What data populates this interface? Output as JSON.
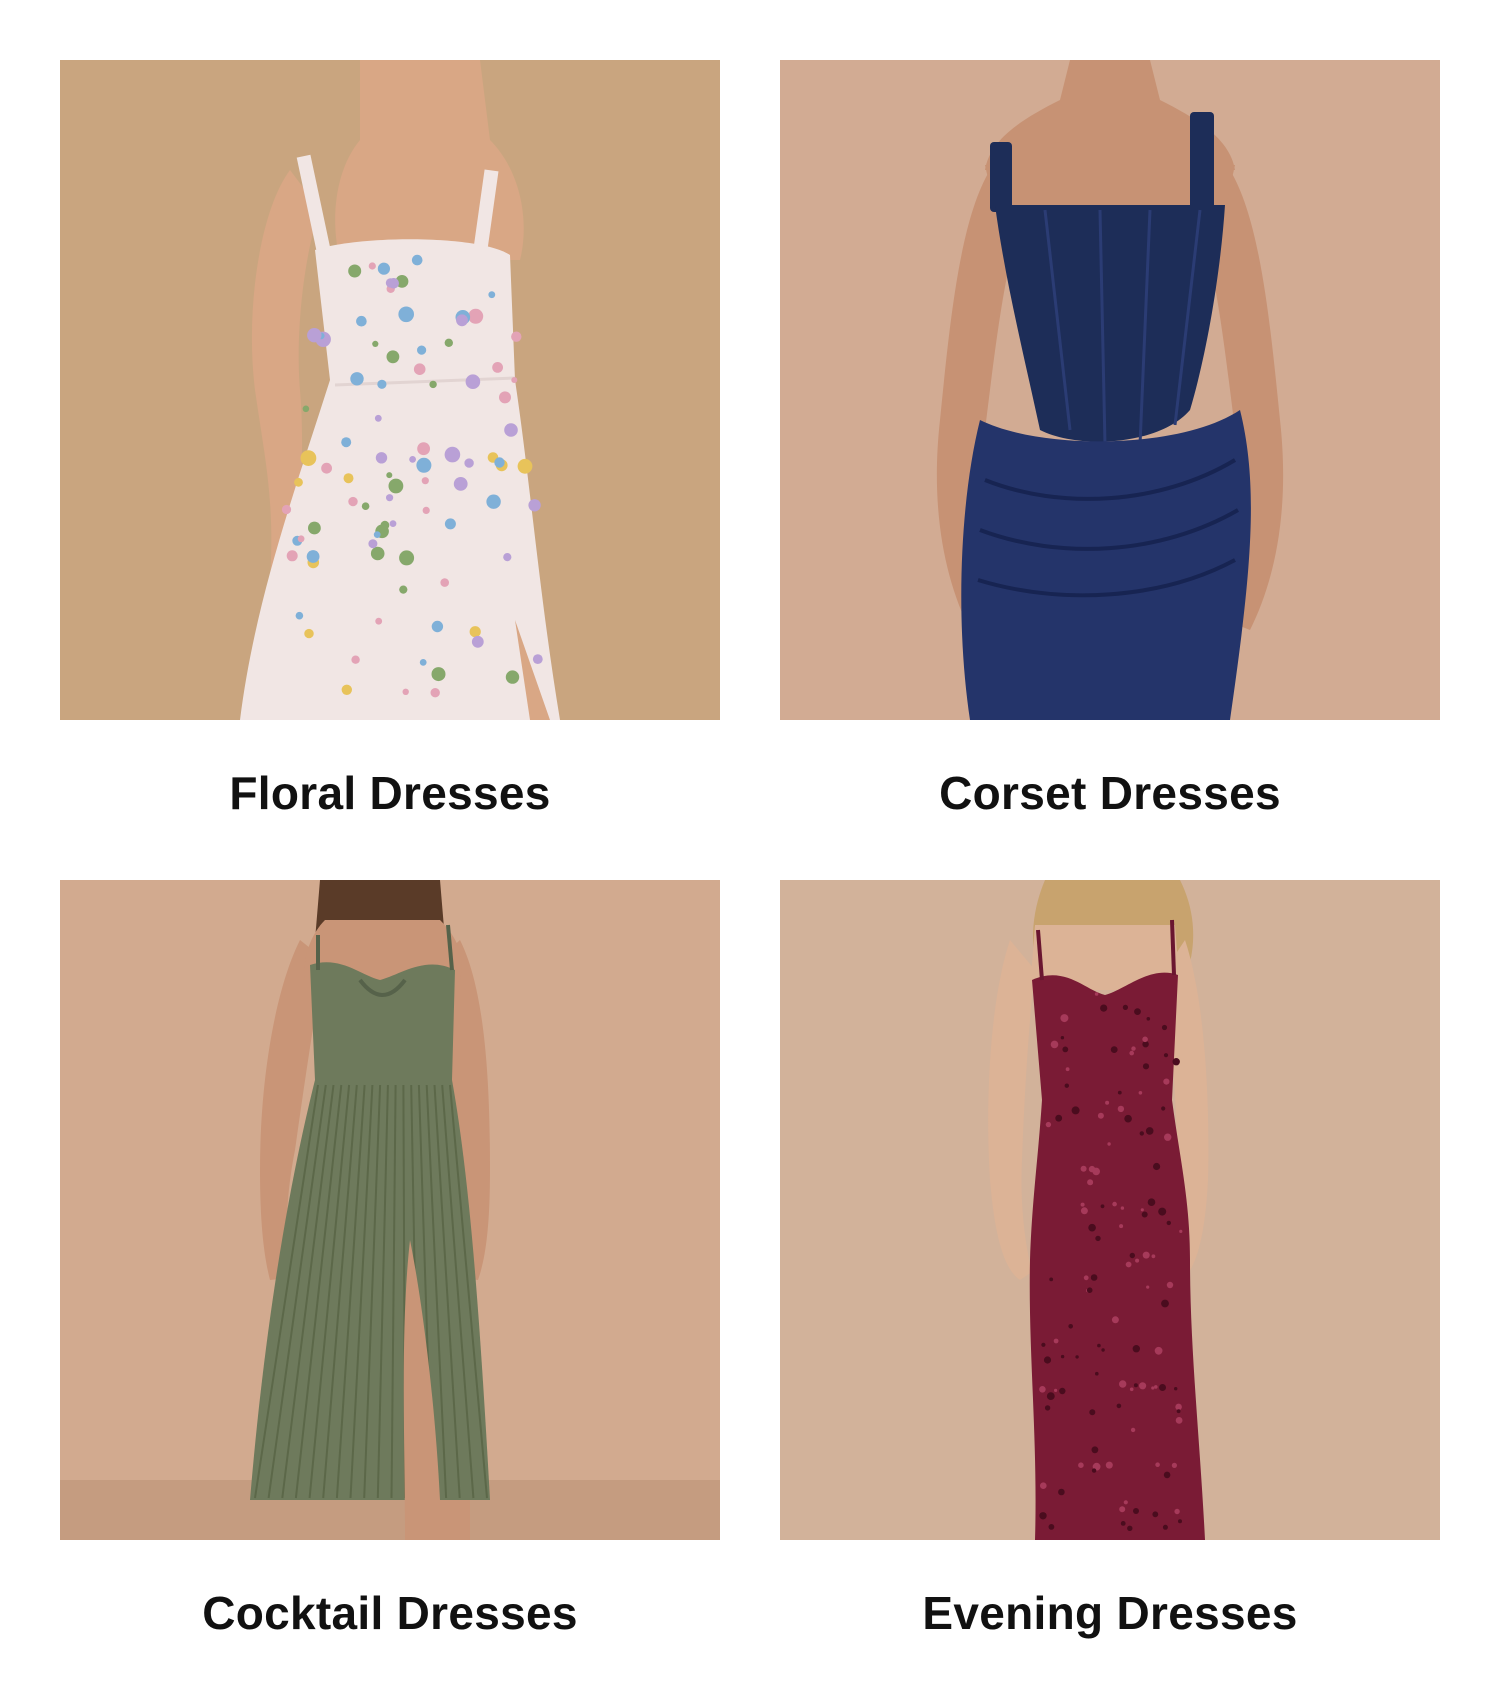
{
  "categories": [
    {
      "label": "Floral Dresses",
      "background": "#c9a57f",
      "dress_color": "#f1e6e4",
      "accent_color": "#7fb0d8",
      "skin_color": "#d9a785"
    },
    {
      "label": "Corset Dresses",
      "background": "#d2ab93",
      "dress_color": "#1d2d58",
      "accent_color": "#24346a",
      "skin_color": "#c79274"
    },
    {
      "label": "Cocktail Dresses",
      "background": "#d2aa8f",
      "dress_color": "#6e7a5c",
      "accent_color": "#57644a",
      "skin_color": "#c99577"
    },
    {
      "label": "Evening Dresses",
      "background": "#d2b29a",
      "dress_color": "#7a1b35",
      "accent_color": "#5c1025",
      "skin_color": "#dcb396"
    }
  ]
}
